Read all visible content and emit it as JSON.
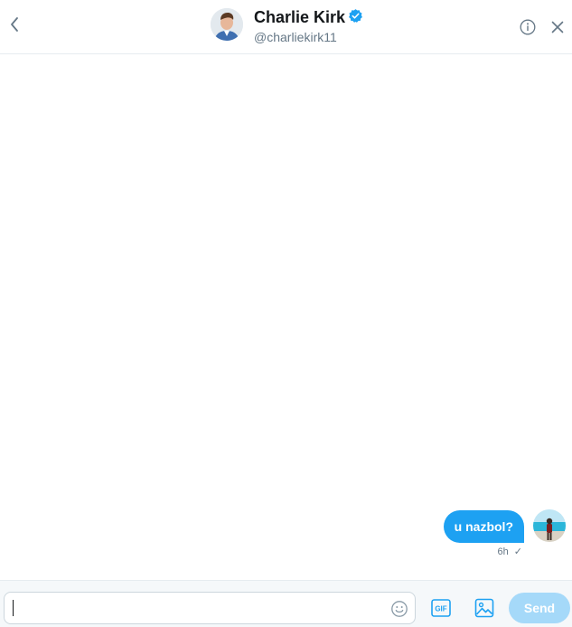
{
  "header": {
    "name": "Charlie Kirk",
    "handle": "@charliekirk11",
    "verified": true,
    "icons": {
      "back": "chevron-left-icon",
      "verified": "verified-badge-icon",
      "info": "info-icon",
      "close": "close-icon"
    }
  },
  "conversation": {
    "messages": [
      {
        "text": "u nazbol?",
        "time": "6h",
        "status": "✓",
        "sender": "self"
      }
    ]
  },
  "composer": {
    "value": "",
    "placeholder": "",
    "send_label": "Send",
    "gif_label": "GIF",
    "icons": {
      "emoji": "emoji-icon",
      "gif": "gif-icon",
      "media": "image-icon"
    }
  },
  "colors": {
    "accent": "#1da1f2",
    "send_disabled": "#a5d9f9",
    "secondary_text": "#657786",
    "border": "#e6ecf0"
  }
}
